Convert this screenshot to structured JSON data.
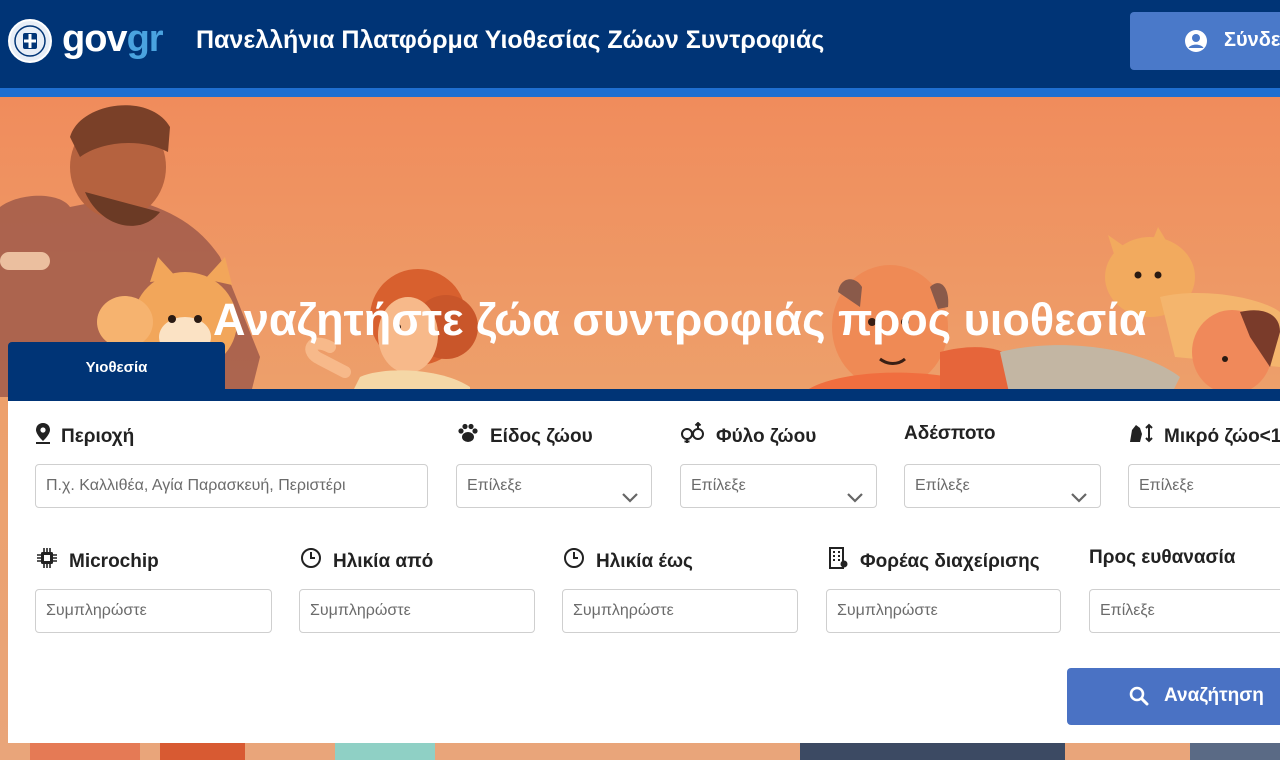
{
  "header": {
    "logo_gov": "gov",
    "logo_gr": "gr",
    "site_title": "Πανελλήνια Πλατφόρμα Υιοθεσίας Ζώων Συντροφιάς",
    "login_label": "Σύνδεση",
    "login_icon": "user-circle-icon",
    "emblem_icon": "greek-emblem-icon"
  },
  "hero": {
    "heading": "Αναζητήστε ζώα συντροφιάς προς υιοθεσία"
  },
  "search_panel": {
    "tab_label": "Υιοθεσία",
    "row1": {
      "area": {
        "label": "Περιοχή",
        "icon": "location-pin-icon",
        "placeholder": "Π.χ. Καλλιθέα, Αγία Παρασκευή, Περιστέρι"
      },
      "species": {
        "label": "Είδος ζώου",
        "icon": "paw-icon",
        "value": "Επίλεξε"
      },
      "sex": {
        "label": "Φύλο ζώου",
        "icon": "gender-icon",
        "value": "Επίλεξε"
      },
      "stray": {
        "label": "Αδέσποτο",
        "value": "Επίλεξε"
      },
      "small": {
        "label": "Μικρό ζώο<1",
        "icon": "animal-size-icon",
        "value": "Επίλεξε"
      }
    },
    "row2": {
      "microchip": {
        "label": "Microchip",
        "icon": "chip-icon",
        "placeholder": "Συμπληρώστε"
      },
      "age_from": {
        "label": "Ηλικία από",
        "icon": "clock-icon",
        "placeholder": "Συμπληρώστε"
      },
      "age_to": {
        "label": "Ηλικία έως",
        "icon": "clock-icon",
        "placeholder": "Συμπληρώστε"
      },
      "agency": {
        "label": "Φορέας διαχείρισης",
        "icon": "building-icon",
        "placeholder": "Συμπληρώστε"
      },
      "euthanasia": {
        "label": "Προς ευθανασία",
        "value": "Επίλεξε"
      }
    },
    "search_label": "Αναζήτηση",
    "search_icon": "search-icon"
  },
  "colors": {
    "header_bg": "#003476",
    "header_stripe": "#1f6fd1",
    "hero_bg": "#f08c5c",
    "button_bg": "#4a72c4",
    "logo_gr": "#4aa3df"
  }
}
